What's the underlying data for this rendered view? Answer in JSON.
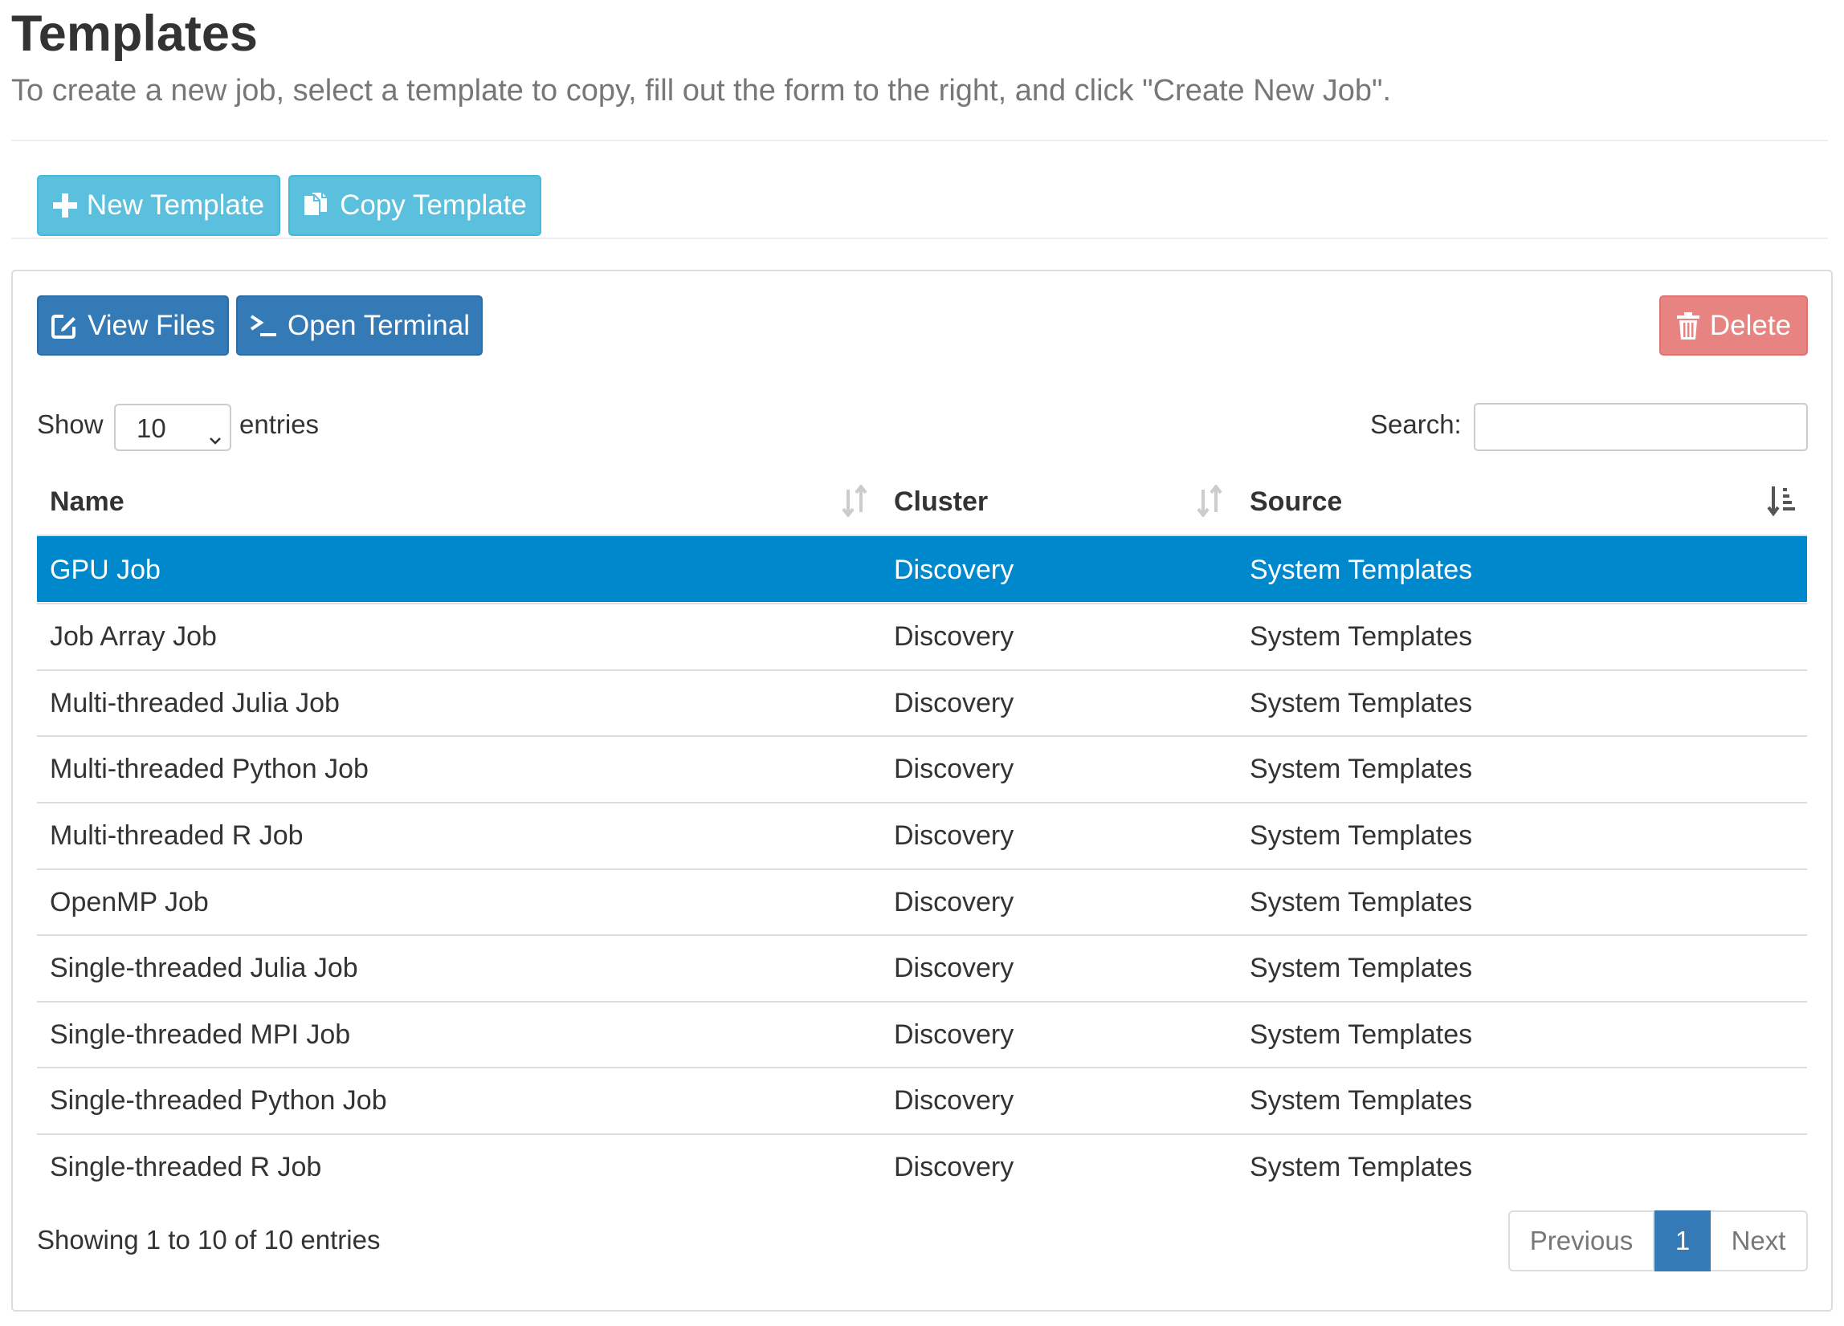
{
  "header": {
    "title": "Templates",
    "subtitle": "To create a new job, select a template to copy, fill out the form to the right, and click \"Create New Job\"."
  },
  "toolbar": {
    "new_template_label": "New Template",
    "copy_template_label": "Copy Template"
  },
  "panel": {
    "view_files_label": "View Files",
    "open_terminal_label": "Open Terminal",
    "delete_label": "Delete"
  },
  "table_controls": {
    "show_label": "Show",
    "entries_label": "entries",
    "page_length": "10",
    "search_label": "Search:",
    "search_value": "",
    "search_placeholder": ""
  },
  "table": {
    "columns": [
      {
        "label": "Name",
        "sort": "unsorted"
      },
      {
        "label": "Cluster",
        "sort": "unsorted"
      },
      {
        "label": "Source",
        "sort": "ascending"
      }
    ],
    "rows": [
      {
        "name": "GPU Job",
        "cluster": "Discovery",
        "source": "System Templates",
        "selected": true
      },
      {
        "name": "Job Array Job",
        "cluster": "Discovery",
        "source": "System Templates",
        "selected": false
      },
      {
        "name": "Multi-threaded Julia Job",
        "cluster": "Discovery",
        "source": "System Templates",
        "selected": false
      },
      {
        "name": "Multi-threaded Python Job",
        "cluster": "Discovery",
        "source": "System Templates",
        "selected": false
      },
      {
        "name": "Multi-threaded R Job",
        "cluster": "Discovery",
        "source": "System Templates",
        "selected": false
      },
      {
        "name": "OpenMP Job",
        "cluster": "Discovery",
        "source": "System Templates",
        "selected": false
      },
      {
        "name": "Single-threaded Julia Job",
        "cluster": "Discovery",
        "source": "System Templates",
        "selected": false
      },
      {
        "name": "Single-threaded MPI Job",
        "cluster": "Discovery",
        "source": "System Templates",
        "selected": false
      },
      {
        "name": "Single-threaded Python Job",
        "cluster": "Discovery",
        "source": "System Templates",
        "selected": false
      },
      {
        "name": "Single-threaded R Job",
        "cluster": "Discovery",
        "source": "System Templates",
        "selected": false
      }
    ]
  },
  "footer": {
    "info": "Showing 1 to 10 of 10 entries",
    "pagination": {
      "previous_label": "Previous",
      "current_page": "1",
      "next_label": "Next"
    }
  },
  "colors": {
    "info_button": "#5bc0de",
    "primary_button": "#337ab7",
    "danger_button_disabled": "#e78481",
    "selected_row": "#0088cc"
  },
  "icons": {
    "new_template": "plus-icon",
    "copy_template": "copy-icon",
    "view_files": "edit-icon",
    "open_terminal": "terminal-icon",
    "delete": "trash-icon",
    "sort_unsorted": "sort-both-icon",
    "sort_ascending": "sort-asc-icon"
  }
}
